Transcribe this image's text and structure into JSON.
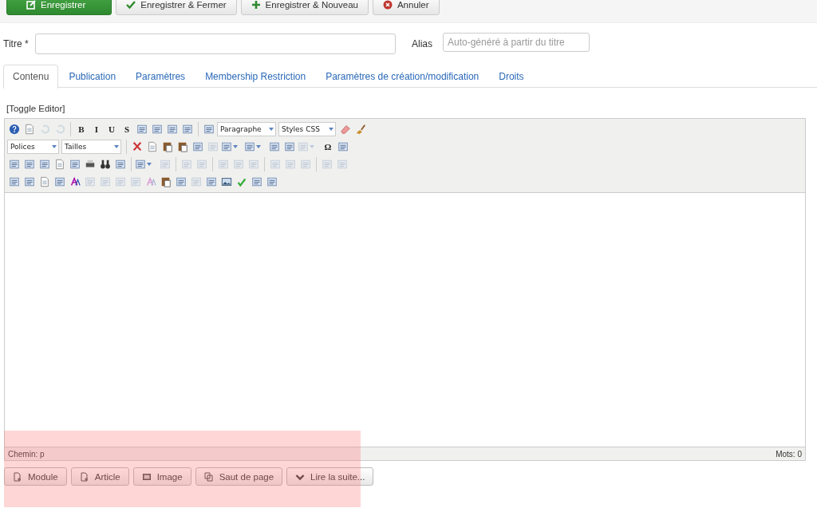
{
  "toolbar": {
    "buttons": [
      {
        "label": "Enregistrer",
        "kind": "primary"
      },
      {
        "label": "Enregistrer & Fermer",
        "kind": "check"
      },
      {
        "label": "Enregistrer & Nouveau",
        "kind": "plus"
      },
      {
        "label": "Annuler",
        "kind": "cancel"
      }
    ]
  },
  "form": {
    "title_label": "Titre *",
    "alias_label": "Alias",
    "alias_placeholder": "Auto-généré à partir du titre"
  },
  "tabs": [
    {
      "label": "Contenu",
      "selected": true
    },
    {
      "label": "Publication",
      "selected": false
    },
    {
      "label": "Paramètres",
      "selected": false
    },
    {
      "label": "Membership Restriction",
      "selected": false
    },
    {
      "label": "Paramètres de création/modification",
      "selected": false
    },
    {
      "label": "Droits",
      "selected": false
    }
  ],
  "editor": {
    "toggle_link": "[Toggle Editor]",
    "rows": [
      [
        {
          "kind": "icon",
          "disabled": false
        },
        {
          "kind": "icon",
          "disabled": false
        },
        {
          "kind": "icon",
          "disabled": true
        },
        {
          "kind": "icon",
          "disabled": true
        },
        {
          "kind": "separator"
        },
        {
          "kind": "letter",
          "label": "B"
        },
        {
          "kind": "letter",
          "label": "I"
        },
        {
          "kind": "letter",
          "label": "U"
        },
        {
          "kind": "letter",
          "label": "S"
        },
        {
          "kind": "icon",
          "disabled": false
        },
        {
          "kind": "icon",
          "disabled": false
        },
        {
          "kind": "icon",
          "disabled": false
        },
        {
          "kind": "icon",
          "disabled": false
        },
        {
          "kind": "separator"
        },
        {
          "kind": "icon",
          "disabled": false
        },
        {
          "kind": "select",
          "label": "Paragraphe"
        },
        {
          "kind": "select",
          "label": "Styles CSS"
        },
        {
          "kind": "icon",
          "disabled": false
        },
        {
          "kind": "icon",
          "disabled": false
        }
      ],
      [
        {
          "kind": "select",
          "label": "Polices"
        },
        {
          "kind": "select",
          "label": "Tailles"
        },
        {
          "kind": "separator"
        },
        {
          "kind": "icon",
          "disabled": false
        },
        {
          "kind": "icon",
          "disabled": false
        },
        {
          "kind": "icon",
          "disabled": false
        },
        {
          "kind": "icon",
          "disabled": false
        },
        {
          "kind": "icon",
          "disabled": false
        },
        {
          "kind": "icon",
          "disabled": true
        },
        {
          "kind": "split",
          "disabled": false
        },
        {
          "kind": "split",
          "disabled": false
        },
        {
          "kind": "icon",
          "disabled": false
        },
        {
          "kind": "icon",
          "disabled": false
        },
        {
          "kind": "split",
          "disabled": true
        },
        {
          "kind": "letter",
          "label": "Ω"
        },
        {
          "kind": "icon",
          "disabled": false
        }
      ],
      [
        {
          "kind": "icon",
          "disabled": false
        },
        {
          "kind": "icon",
          "disabled": false
        },
        {
          "kind": "icon",
          "disabled": false
        },
        {
          "kind": "icon",
          "disabled": false
        },
        {
          "kind": "icon",
          "disabled": false
        },
        {
          "kind": "icon",
          "disabled": false
        },
        {
          "kind": "icon",
          "disabled": false
        },
        {
          "kind": "icon",
          "disabled": false
        },
        {
          "kind": "separator"
        },
        {
          "kind": "split",
          "disabled": false
        },
        {
          "kind": "icon",
          "disabled": true
        },
        {
          "kind": "separator"
        },
        {
          "kind": "icon",
          "disabled": true
        },
        {
          "kind": "icon",
          "disabled": true
        },
        {
          "kind": "separator"
        },
        {
          "kind": "icon",
          "disabled": true
        },
        {
          "kind": "icon",
          "disabled": true
        },
        {
          "kind": "icon",
          "disabled": true
        },
        {
          "kind": "separator"
        },
        {
          "kind": "icon",
          "disabled": true
        },
        {
          "kind": "icon",
          "disabled": true
        },
        {
          "kind": "icon",
          "disabled": true
        },
        {
          "kind": "separator"
        },
        {
          "kind": "icon",
          "disabled": true
        },
        {
          "kind": "icon",
          "disabled": true
        }
      ],
      [
        {
          "kind": "icon",
          "disabled": false
        },
        {
          "kind": "icon",
          "disabled": false
        },
        {
          "kind": "icon",
          "disabled": false
        },
        {
          "kind": "icon",
          "disabled": false
        },
        {
          "kind": "icon",
          "disabled": false
        },
        {
          "kind": "icon",
          "disabled": true
        },
        {
          "kind": "icon",
          "disabled": true
        },
        {
          "kind": "icon",
          "disabled": true
        },
        {
          "kind": "icon",
          "disabled": true
        },
        {
          "kind": "icon",
          "disabled": true
        },
        {
          "kind": "icon",
          "disabled": false
        },
        {
          "kind": "icon",
          "disabled": false
        },
        {
          "kind": "icon",
          "disabled": true
        },
        {
          "kind": "icon",
          "disabled": false
        },
        {
          "kind": "icon",
          "disabled": false
        },
        {
          "kind": "icon",
          "disabled": false
        },
        {
          "kind": "icon",
          "disabled": false
        },
        {
          "kind": "icon",
          "disabled": false
        }
      ]
    ],
    "path": "Chemin: p",
    "word_count": "Mots: 0"
  },
  "insert_buttons": [
    {
      "label": "Module"
    },
    {
      "label": "Article"
    },
    {
      "label": "Image"
    },
    {
      "label": "Saut de page"
    },
    {
      "label": "Lire la suite..."
    }
  ]
}
